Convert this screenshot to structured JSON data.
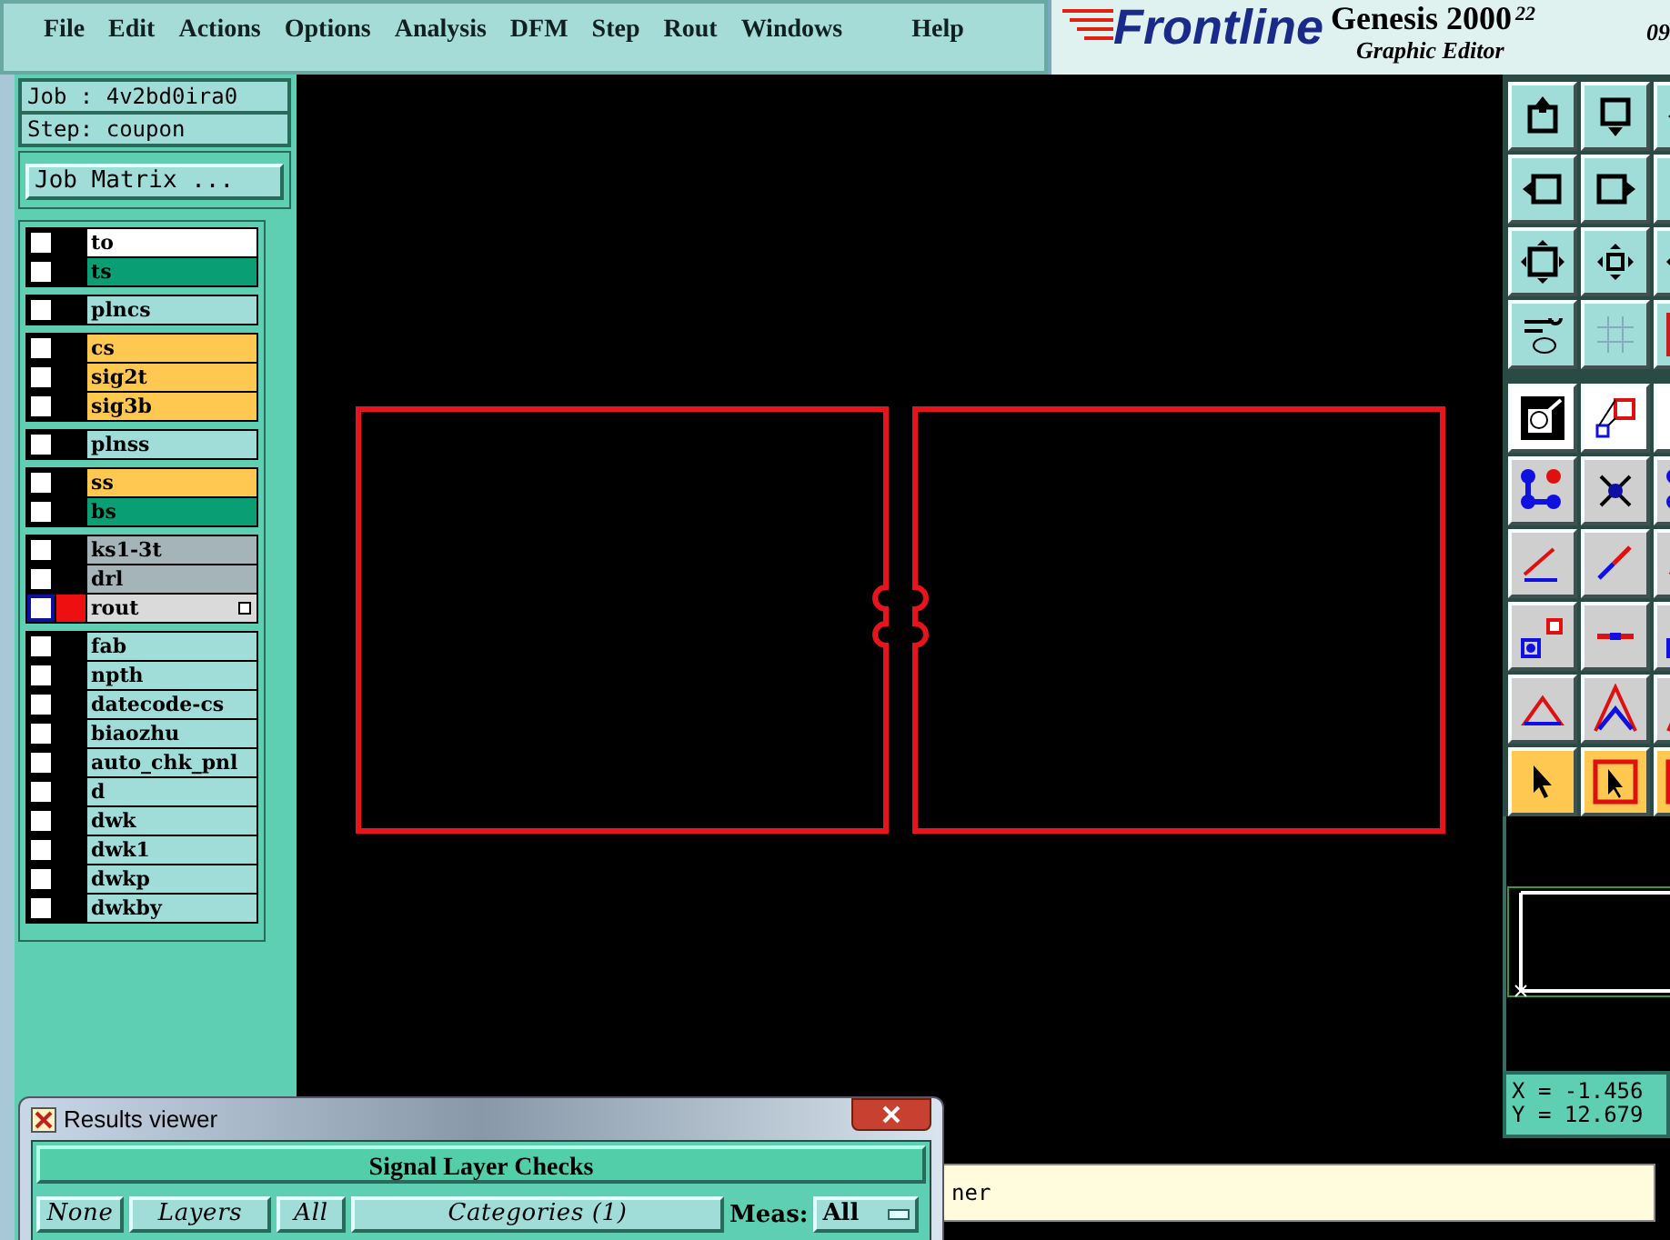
{
  "menu": [
    "File",
    "Edit",
    "Actions",
    "Options",
    "Analysis",
    "DFM",
    "Step",
    "Rout",
    "Windows",
    "Help"
  ],
  "branding": {
    "logo": "Frontline",
    "product": "Genesis 2000",
    "version_fragment": "22",
    "date_fragment": "09",
    "subtitle": "Graphic Editor"
  },
  "job": {
    "job_label": "Job : 4v2bd0ira0",
    "step_label": "Step: coupon",
    "matrix_button": "Job Matrix ..."
  },
  "layer_groups": [
    {
      "layers": [
        {
          "name": "to",
          "color": "#ffffff",
          "active": false,
          "checked": false
        },
        {
          "name": "ts",
          "color": "#0a9e74",
          "active": false,
          "checked": false
        }
      ]
    },
    {
      "layers": [
        {
          "name": "plncs",
          "color": "#a0dcd8",
          "active": false,
          "checked": false
        }
      ]
    },
    {
      "layers": [
        {
          "name": "cs",
          "color": "#ffc850",
          "active": false,
          "checked": false
        },
        {
          "name": "sig2t",
          "color": "#ffc850",
          "active": false,
          "checked": false
        },
        {
          "name": "sig3b",
          "color": "#ffc850",
          "active": false,
          "checked": false
        }
      ]
    },
    {
      "layers": [
        {
          "name": "plnss",
          "color": "#a0dcd8",
          "active": false,
          "checked": false
        }
      ]
    },
    {
      "layers": [
        {
          "name": "ss",
          "color": "#ffc850",
          "active": false,
          "checked": false
        },
        {
          "name": "bs",
          "color": "#0a9e74",
          "active": false,
          "checked": false
        }
      ]
    },
    {
      "layers": [
        {
          "name": "ks1-3t",
          "color": "#a4b4b8",
          "active": false,
          "checked": false
        },
        {
          "name": "drl",
          "color": "#a4b4b8",
          "active": false,
          "checked": false
        },
        {
          "name": "rout",
          "color": "#dadada",
          "active": true,
          "checked": false
        }
      ]
    },
    {
      "layers": [
        {
          "name": "fab",
          "color": "#a0dcd8",
          "active": false,
          "checked": false
        },
        {
          "name": "npth",
          "color": "#a0dcd8",
          "active": false,
          "checked": false
        },
        {
          "name": "datecode-cs",
          "color": "#a0dcd8",
          "active": false,
          "checked": false
        },
        {
          "name": "biaozhu",
          "color": "#a0dcd8",
          "active": false,
          "checked": false
        },
        {
          "name": "auto_chk_pnl",
          "color": "#a0dcd8",
          "active": false,
          "checked": false
        },
        {
          "name": "d",
          "color": "#a0dcd8",
          "active": false,
          "checked": false
        },
        {
          "name": "dwk",
          "color": "#a0dcd8",
          "active": false,
          "checked": false
        },
        {
          "name": "dwk1",
          "color": "#a0dcd8",
          "active": false,
          "checked": false
        },
        {
          "name": "dwkp",
          "color": "#a0dcd8",
          "active": false,
          "checked": false
        },
        {
          "name": "dwkby",
          "color": "#a0dcd8",
          "active": false,
          "checked": false
        }
      ]
    }
  ],
  "coordinates": {
    "x": "X = -1.456",
    "y": "Y = 12.679"
  },
  "status_bar": {
    "message": "ner"
  },
  "results_viewer": {
    "title": "Results viewer",
    "header_button": "Signal Layer Checks",
    "controls": [
      {
        "label": "None",
        "kind": "button"
      },
      {
        "label": "Layers",
        "kind": "button"
      },
      {
        "label": "All",
        "kind": "button"
      },
      {
        "label": "Categories (1)",
        "kind": "button"
      },
      {
        "label": "Meas:",
        "kind": "label"
      },
      {
        "label": "All",
        "kind": "dropdown"
      }
    ]
  }
}
